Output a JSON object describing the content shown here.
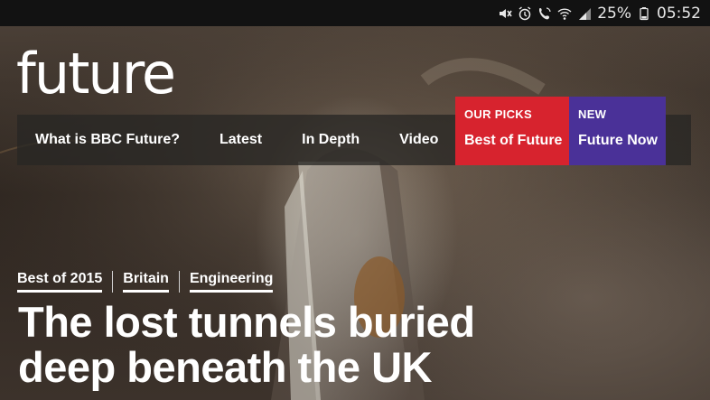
{
  "status_bar": {
    "battery_percent": "25%",
    "time": "05:52",
    "icons": [
      "mute-icon",
      "alarm-icon",
      "call-icon",
      "wifi-icon",
      "signal-icon",
      "battery-icon"
    ]
  },
  "header": {
    "logo_text": "future"
  },
  "nav": {
    "items": [
      {
        "label": "What is BBC Future?"
      },
      {
        "label": "Latest"
      },
      {
        "label": "In Depth"
      },
      {
        "label": "Video"
      }
    ],
    "our_picks": {
      "kicker": "OUR PICKS",
      "title": "Best of Future",
      "color": "#d7232e"
    },
    "new": {
      "kicker": "NEW",
      "title": "Future Now",
      "color": "#4a3198"
    }
  },
  "article": {
    "tags": [
      "Best of 2015",
      "Britain",
      "Engineering"
    ],
    "headline_line1": "The lost tunnels buried",
    "headline_line2": "deep beneath the UK"
  }
}
